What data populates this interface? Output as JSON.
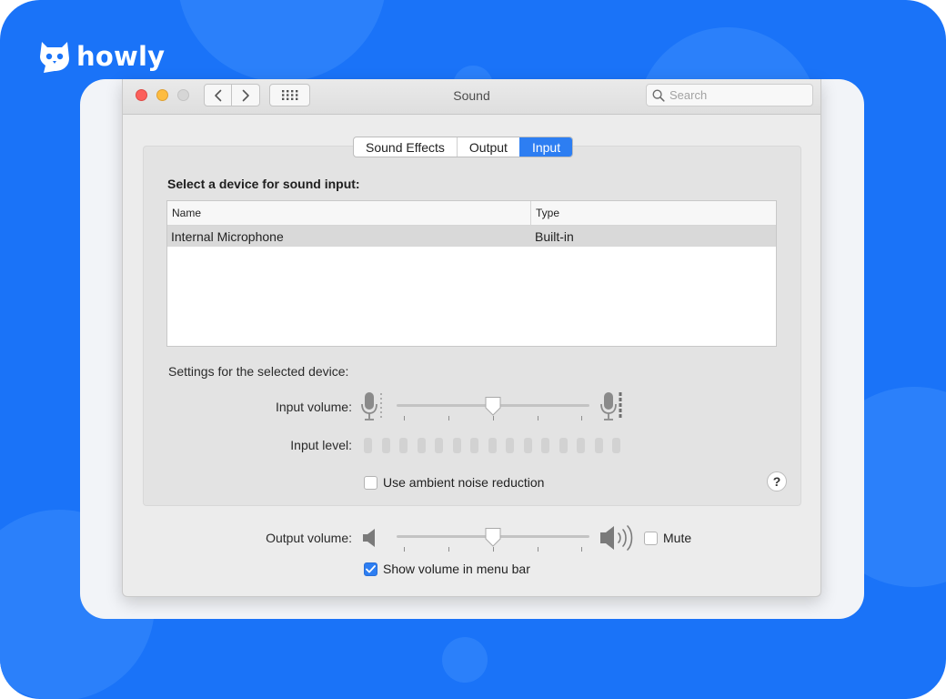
{
  "brand": {
    "name": "howly"
  },
  "window": {
    "title": "Sound",
    "search_placeholder": "Search"
  },
  "tabs": [
    {
      "label": "Sound Effects",
      "active": false
    },
    {
      "label": "Output",
      "active": false
    },
    {
      "label": "Input",
      "active": true
    }
  ],
  "input": {
    "section_title": "Select a device for sound input:",
    "table": {
      "columns": [
        "Name",
        "Type"
      ],
      "rows": [
        {
          "name": "Internal Microphone",
          "type": "Built-in",
          "selected": true
        }
      ]
    },
    "settings_title": "Settings for the selected device:",
    "input_volume_label": "Input volume:",
    "input_volume_value": 0.5,
    "input_level_label": "Input level:",
    "input_level_segments": 15,
    "input_level_active": 0,
    "ambient_label": "Use ambient noise reduction",
    "ambient_checked": false,
    "help_label": "?"
  },
  "output": {
    "output_volume_label": "Output volume:",
    "output_volume_value": 0.5,
    "mute_label": "Mute",
    "mute_checked": false,
    "show_volume_label": "Show volume in menu bar",
    "show_volume_checked": true
  },
  "icons": {
    "back": "chevron-left-icon",
    "forward": "chevron-right-icon",
    "grid": "grid-icon",
    "search": "search-icon",
    "mic_low": "microphone-low-icon",
    "mic_high": "microphone-high-icon",
    "speaker_low": "speaker-low-icon",
    "speaker_high": "speaker-high-icon",
    "checkmark": "checkmark-icon"
  },
  "colors": {
    "background_blue": "#1a73f8",
    "accent": "#2d7ef2",
    "traffic_red": "#fc605c",
    "traffic_yellow": "#fdbc40"
  }
}
